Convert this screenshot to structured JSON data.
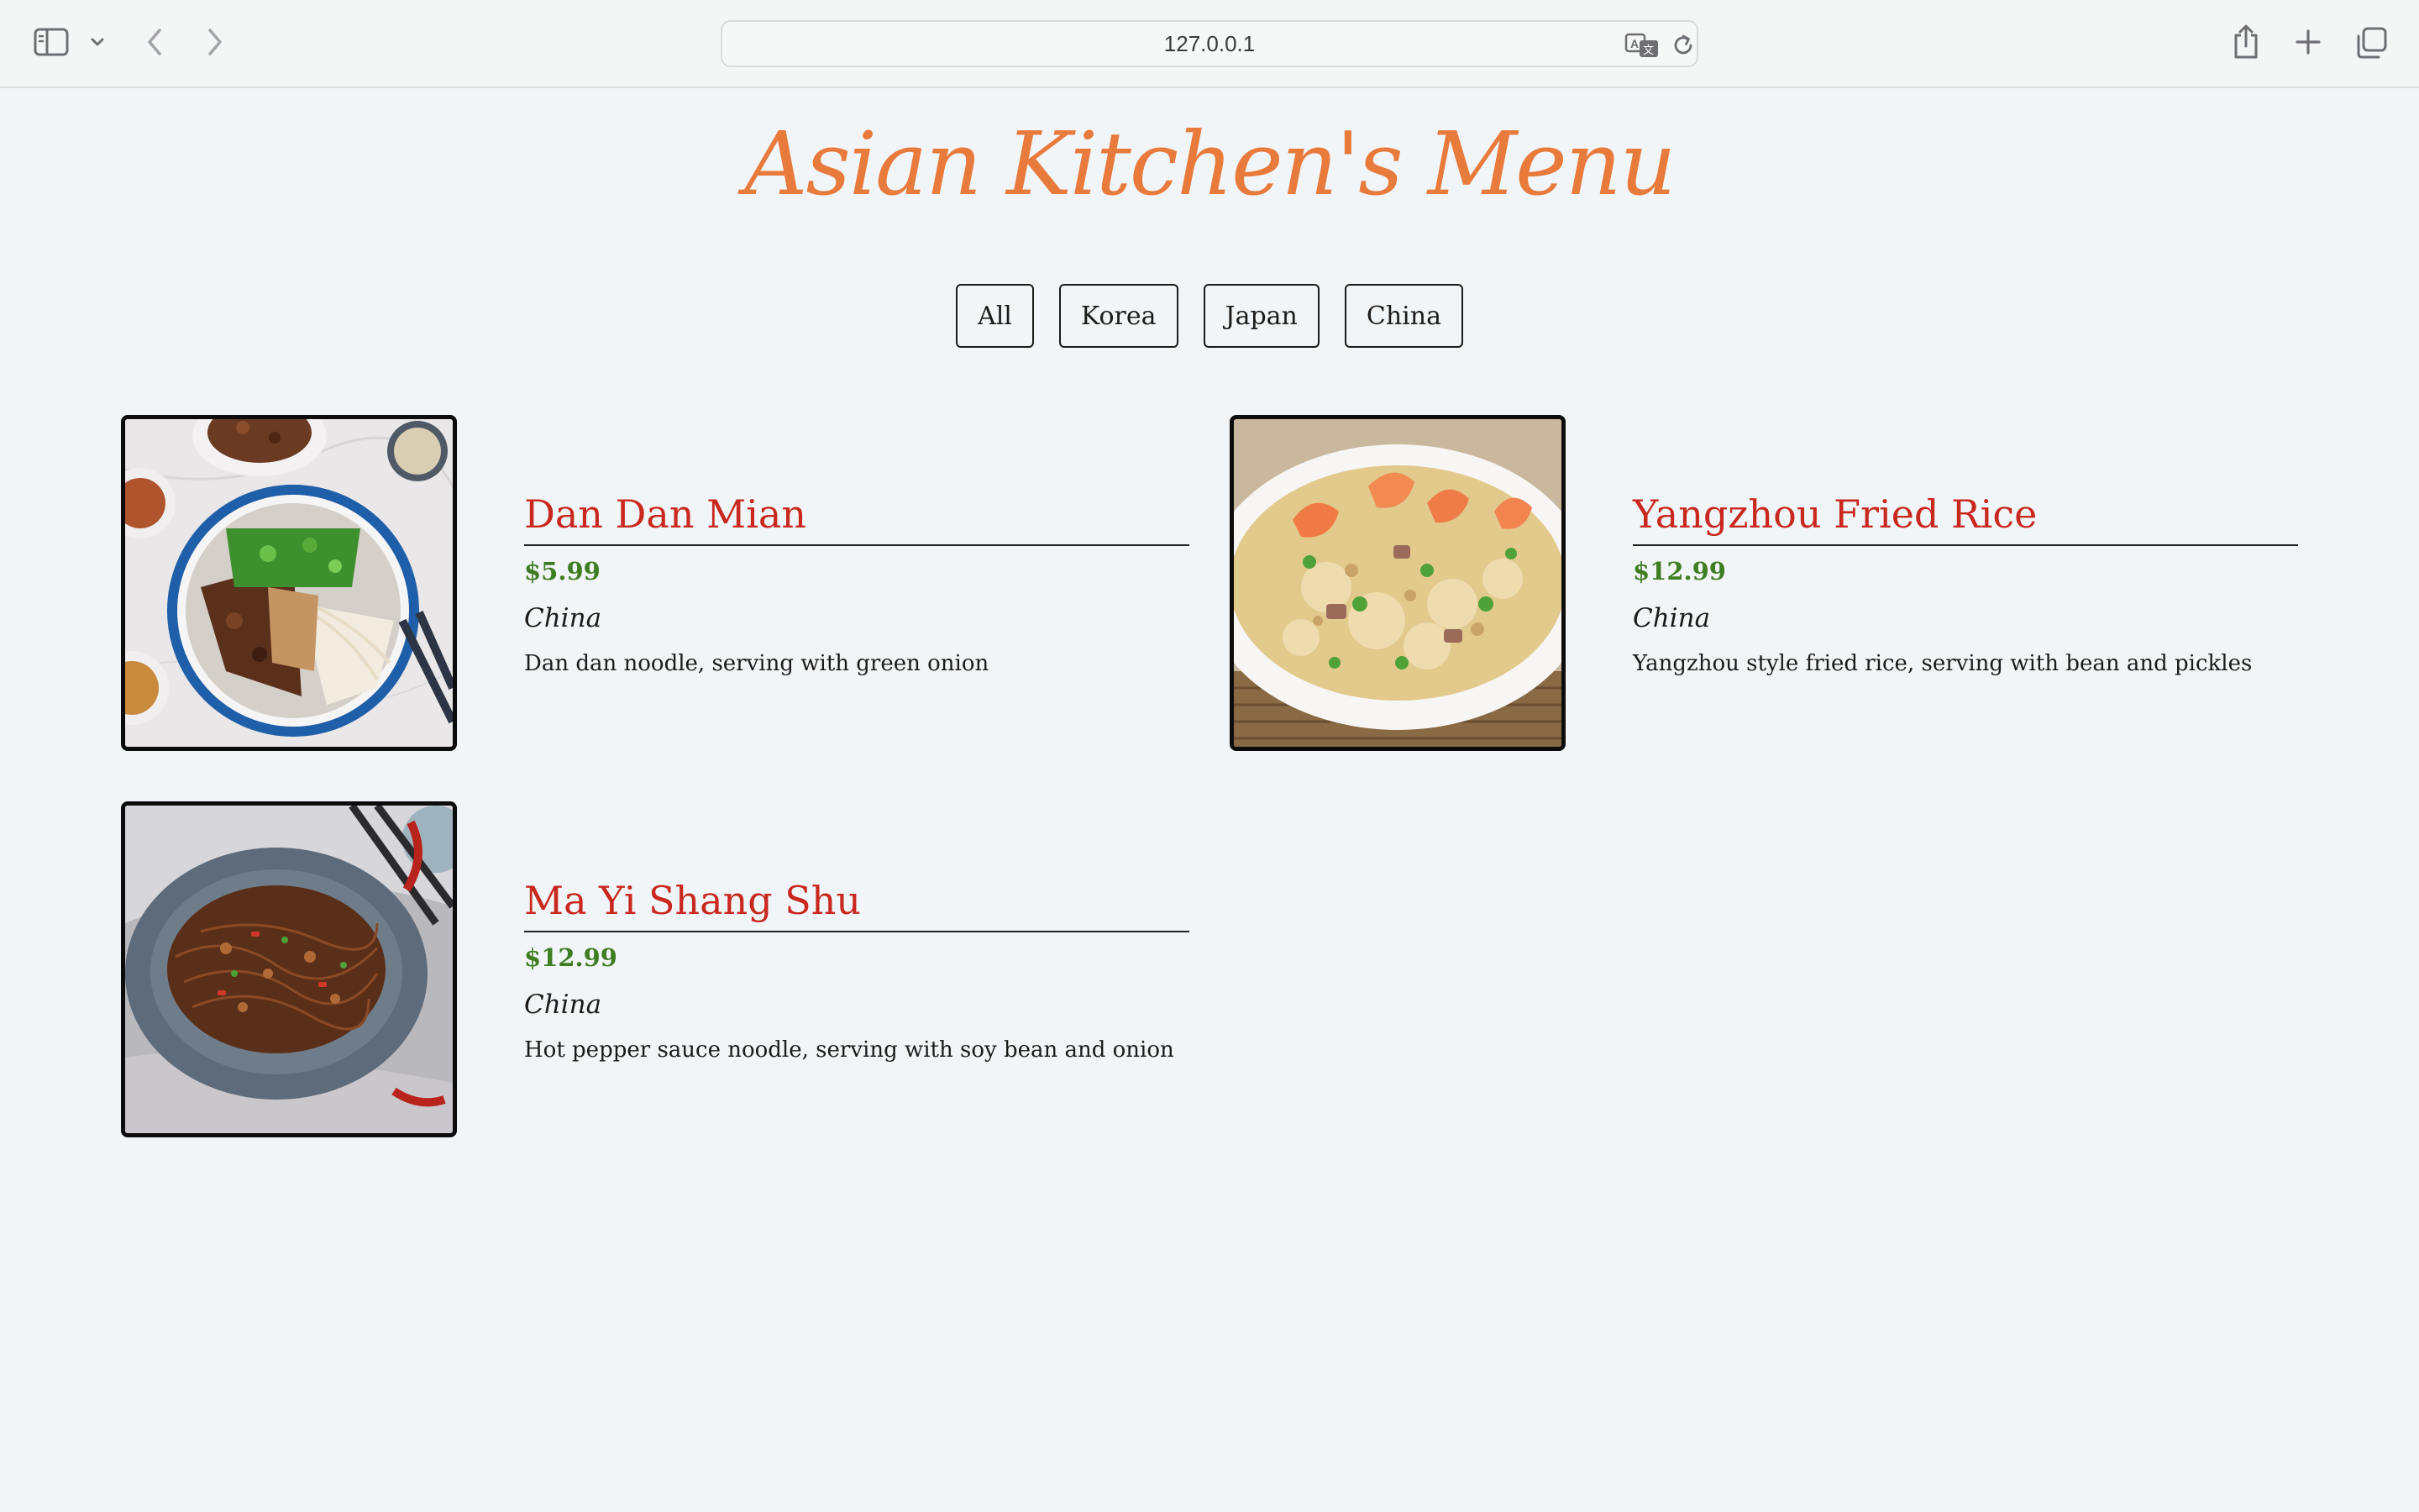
{
  "browser": {
    "url": "127.0.0.1",
    "icons": [
      "sidebar-icon",
      "chevron-down-icon",
      "back-arrow-icon",
      "forward-arrow-icon",
      "translate-icon",
      "reload-icon",
      "share-icon",
      "plus-icon",
      "tabs-overview-icon"
    ]
  },
  "page": {
    "title": "Asian Kitchen's Menu",
    "title_color": "#e87a3c"
  },
  "filters": [
    {
      "label": "All"
    },
    {
      "label": "Korea"
    },
    {
      "label": "Japan"
    },
    {
      "label": "China"
    }
  ],
  "menu": [
    {
      "name": "Dan Dan Mian",
      "price": "$5.99",
      "origin": "China",
      "description": "Dan dan noodle, serving with green onion"
    },
    {
      "name": "Yangzhou Fried Rice",
      "price": "$12.99",
      "origin": "China",
      "description": "Yangzhou style fried rice, serving with bean and pickles"
    },
    {
      "name": "Ma Yi Shang Shu",
      "price": "$12.99",
      "origin": "China",
      "description": "Hot pepper sauce noodle, serving with soy bean and onion"
    }
  ],
  "colors": {
    "name": "#c8281e",
    "price": "#3f7d22",
    "background": "#f2f5f8"
  }
}
